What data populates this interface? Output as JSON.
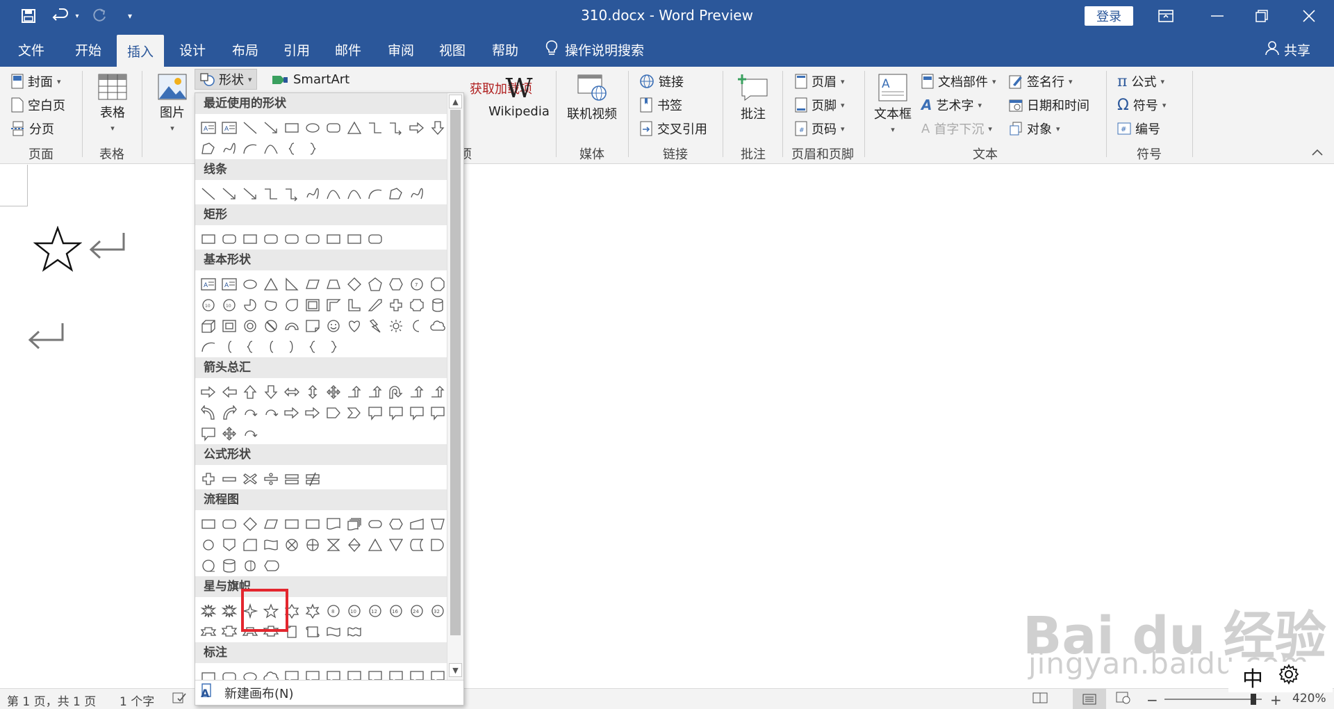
{
  "titlebar": {
    "doc_title": "310.docx  -  Word Preview",
    "login": "登录"
  },
  "tabs": [
    "文件",
    "开始",
    "插入",
    "设计",
    "布局",
    "引用",
    "邮件",
    "审阅",
    "视图",
    "帮助"
  ],
  "active_tab": "插入",
  "tell_me": "操作说明搜索",
  "share": "共享",
  "ribbon": {
    "pages": {
      "cover": "封面",
      "blank": "空白页",
      "break": "分页",
      "group": "页面"
    },
    "table": {
      "label": "表格",
      "group": "表格"
    },
    "illustrations": {
      "picture": "图片",
      "shapes": "形状",
      "smartart": "SmartArt"
    },
    "addins": {
      "get": "获取加载项",
      "wikipedia": "Wikipedia",
      "group": "加载项"
    },
    "media": {
      "video": "联机视频",
      "group": "媒体"
    },
    "links": {
      "link": "链接",
      "bookmark": "书签",
      "crossref": "交叉引用",
      "group": "链接"
    },
    "comments": {
      "comment": "批注",
      "group": "批注"
    },
    "headerfooter": {
      "header": "页眉",
      "footer": "页脚",
      "pagenum": "页码",
      "group": "页眉和页脚"
    },
    "text": {
      "textbox": "文本框",
      "quickparts": "文档部件",
      "wordart": "艺术字",
      "dropcap": "首字下沉",
      "signature": "签名行",
      "datetime": "日期和时间",
      "object": "对象",
      "group": "文本"
    },
    "symbols": {
      "equation": "公式",
      "symbol": "符号",
      "number": "编号",
      "group": "符号"
    }
  },
  "shapes_panel": {
    "categories": [
      "最近使用的形状",
      "线条",
      "矩形",
      "基本形状",
      "箭头总汇",
      "公式形状",
      "流程图",
      "星与旗帜",
      "标注"
    ],
    "new_canvas": "新建画布(N)"
  },
  "statusbar": {
    "page": "第 1 页，共 1 页",
    "words": "1 个字",
    "zoom": "420%"
  },
  "watermark": {
    "text": "jingyan.baidu.com",
    "logo": "Bai du 经验"
  },
  "ime": "中"
}
